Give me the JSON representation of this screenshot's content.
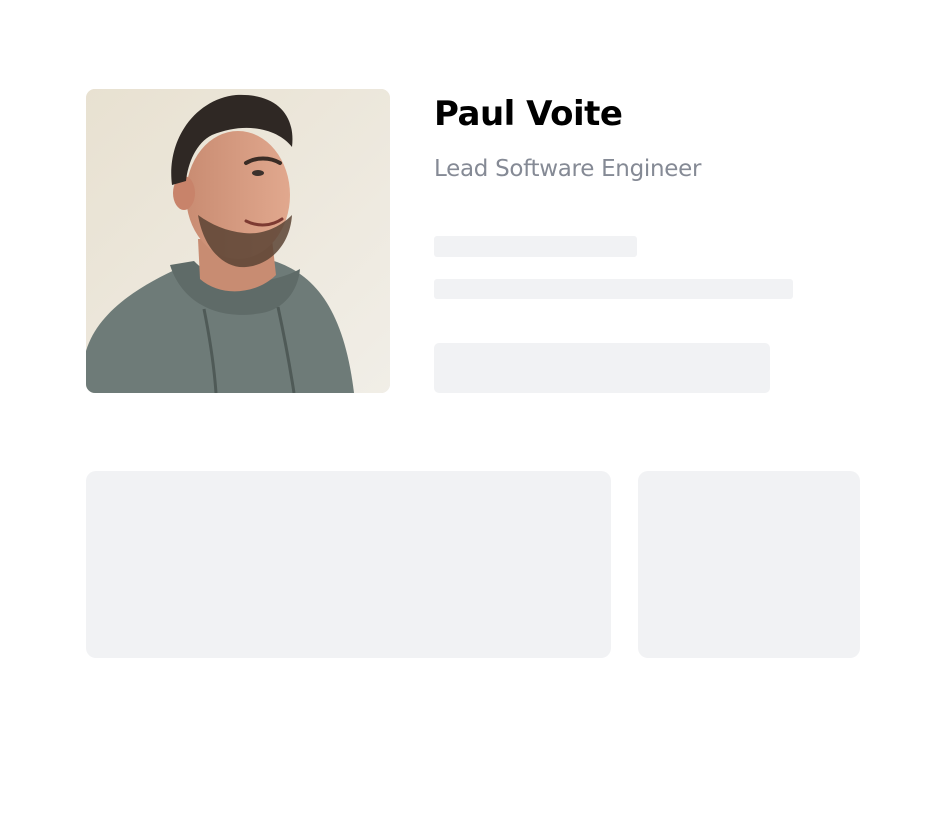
{
  "profile": {
    "name": "Paul Voite",
    "role": "Lead Software Engineer",
    "photo_icon": "profile-photo"
  },
  "colors": {
    "page_background": "#ffffff",
    "name_text": "#000000",
    "role_text": "#858a95",
    "skeleton_fill": "#f1f2f4",
    "hoodie": "#6e7b78"
  }
}
